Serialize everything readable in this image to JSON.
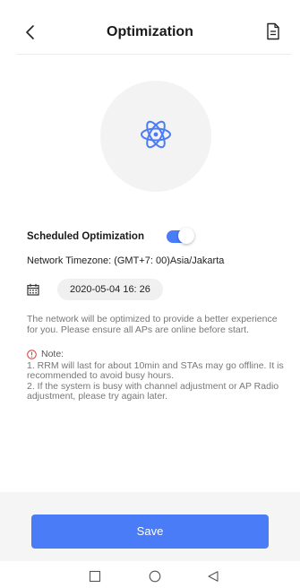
{
  "header": {
    "title": "Optimization",
    "back_icon": "chevron-left-icon",
    "doc_icon": "document-icon"
  },
  "hero": {
    "icon": "atom-icon",
    "accent_color": "#4a7cf7"
  },
  "schedule": {
    "label": "Scheduled Optimization",
    "enabled": true,
    "timezone_text": "Network Timezone: (GMT+7: 00)Asia/Jakarta",
    "calendar_icon": "calendar-icon",
    "date_value": "2020-05-04 16: 26"
  },
  "description": "The network will be optimized to provide a better experience for you. Please ensure all APs are online before start.",
  "note": {
    "icon": "alert-circle-icon",
    "title": "Note:",
    "line1": "1. RRM will last for about 10min and STAs may go offline. It is recommended to avoid busy hours.",
    "line2": "2. If the system is busy with channel adjustment or AP Radio adjustment, please try again later."
  },
  "footer": {
    "save_label": "Save",
    "button_color": "#4a7cf7"
  },
  "system_nav": {
    "recent_icon": "square-icon",
    "home_icon": "circle-icon",
    "back_icon": "triangle-back-icon"
  }
}
